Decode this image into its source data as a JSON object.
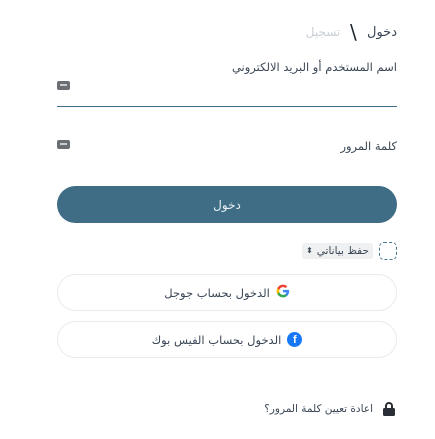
{
  "tabs": {
    "active_label": "دخول",
    "separator": "/",
    "inactive_label": "تسجيل"
  },
  "username": {
    "label": "اسم المستخدم أو البريد الالكتروني"
  },
  "password": {
    "label": "كلمة المرور"
  },
  "login_button": {
    "label": "دخول"
  },
  "remember": {
    "label": "حفظ بياناتي",
    "stepper": "⬍"
  },
  "social": {
    "google_label": "الدخول بحساب جوجل",
    "facebook_label": "الدخول بحساب الفيس بوك"
  },
  "reset": {
    "label": "اعادة تعيين كلمة المرور؟"
  },
  "icons": {
    "google": "G",
    "facebook": "f"
  },
  "colors": {
    "primary": "#3f6d85",
    "facebook": "#1877f2",
    "google_blue": "#4285f4"
  }
}
